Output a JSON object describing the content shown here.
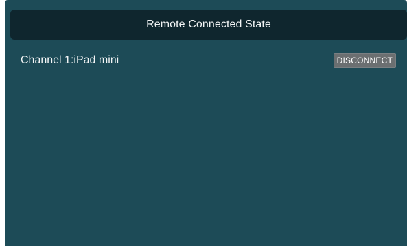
{
  "header": {
    "title": "Remote Connected State"
  },
  "channels": [
    {
      "label": "Channel 1:iPad mini",
      "action_label": "DISCONNECT"
    }
  ],
  "colors": {
    "panel_background": "#1d4b57",
    "header_background": "#0f262e",
    "button_background": "#6b6f71",
    "divider": "#5da6bd"
  }
}
